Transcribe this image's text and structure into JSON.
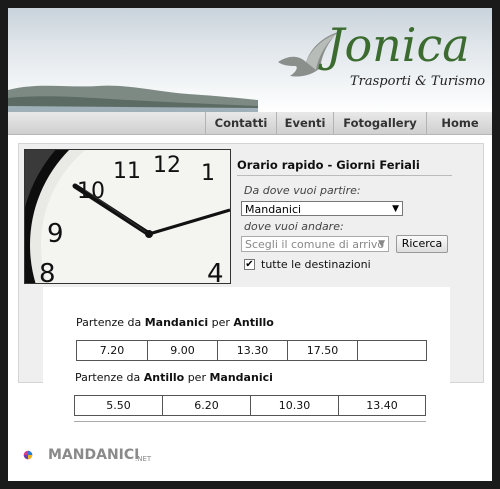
{
  "brand": {
    "name": "Jonica",
    "tagline": "Trasporti & Turismo"
  },
  "nav": {
    "items": [
      "Contatti",
      "Eventi",
      "Fotogallery",
      "Home"
    ]
  },
  "form": {
    "title": "Orario rapido - Giorni Feriali",
    "from_label": "Da dove vuoi partire:",
    "from_value": "Mandanici",
    "to_label": "dove vuoi andare:",
    "to_placeholder": "Scegli il comune di arrivo",
    "search_label": "Ricerca",
    "all_destinations_label": "tutte le destinazioni",
    "all_destinations_checked": true
  },
  "routes": [
    {
      "prefix": "Partenze da",
      "from": "Mandanici",
      "mid": "per",
      "to": "Antillo",
      "times": [
        "7.20",
        "9.00",
        "13.30",
        "17.50",
        ""
      ]
    },
    {
      "prefix": "Partenze da",
      "from": "Antillo",
      "mid": "per",
      "to": "Mandanici",
      "times": [
        "5.50",
        "6.20",
        "10.30",
        "13.40"
      ]
    }
  ],
  "watermark": {
    "name": "MANDANICI",
    "suffix": ".NET"
  },
  "colors": {
    "brand_green": "#3b6b2f",
    "panel_bg": "#efefef",
    "page_bg": "#1a1a1a"
  },
  "clock_numbers": [
    "10",
    "11",
    "12",
    "1",
    "9",
    "8",
    "4"
  ]
}
